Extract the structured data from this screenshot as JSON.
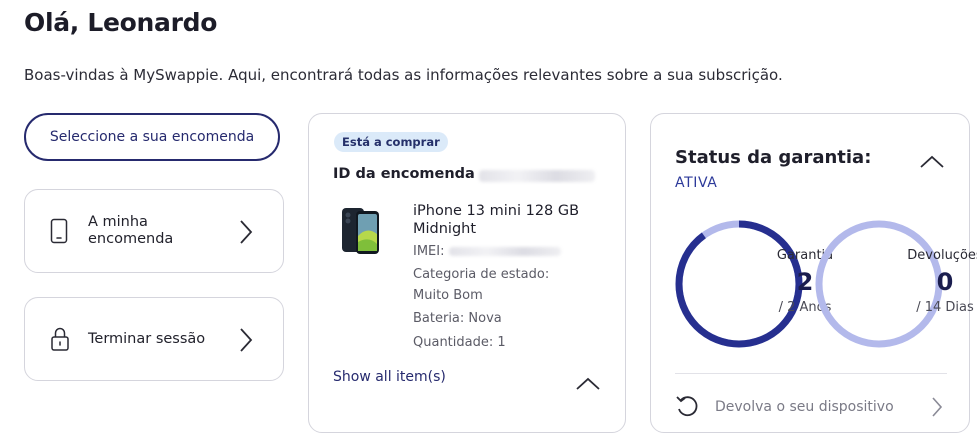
{
  "header": {
    "greeting": "Olá, Leonardo",
    "welcome": "Boas-vindas à MySwappie. Aqui, encontrará todas as informações relevantes sobre a sua subscrição."
  },
  "sidebar": {
    "select_order_label": "Seleccione a sua encomenda",
    "items": [
      {
        "label": "A minha encomenda",
        "icon": "phone-icon"
      },
      {
        "label": "Terminar sessão",
        "icon": "lock-icon"
      }
    ]
  },
  "order": {
    "badge": "Está a comprar",
    "id_label": "ID da encomenda",
    "product_name": "iPhone 13 mini 128 GB Midnight",
    "imei_label": "IMEI:",
    "condition_label": "Categoria de estado:",
    "condition_value": "Muito Bom",
    "battery": "Bateria: Nova",
    "quantity": "Quantidade: 1",
    "show_all": "Show all item(s)"
  },
  "warranty": {
    "title": "Status da garantia:",
    "status": "ATIVA",
    "guarantee": {
      "label": "Garantia",
      "value": "2",
      "unit": "/ 2 Anos",
      "progress": 0.9
    },
    "returns": {
      "label": "Devoluções",
      "value": "0",
      "unit": "/ 14 Dias",
      "progress": 0.0
    },
    "return_device": "Devolva o seu dispositivo"
  },
  "colors": {
    "brand_navy": "#262a6e",
    "gauge_dark": "#262f8f",
    "gauge_light": "#b3b9eb",
    "badge_bg": "#dbeaf9"
  }
}
